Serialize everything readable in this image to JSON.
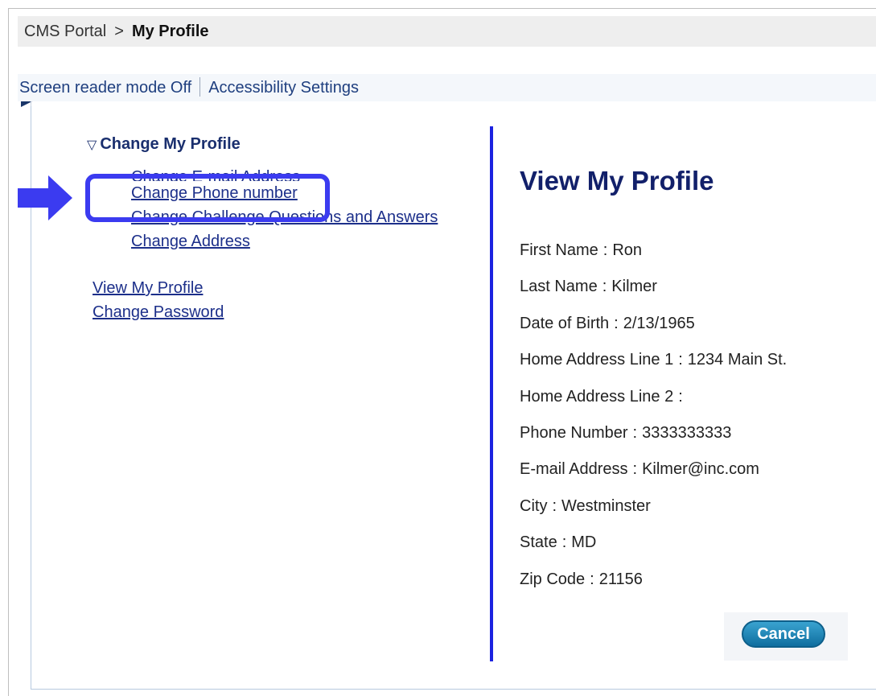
{
  "breadcrumb": {
    "root": "CMS Portal",
    "separator": ">",
    "current": "My Profile"
  },
  "accessibility": {
    "screen_reader": "Screen reader mode Off",
    "settings": "Accessibility Settings"
  },
  "menu": {
    "heading_icon": "▽",
    "heading": "Change My Profile",
    "items": [
      {
        "label": "Change E-mail Address"
      },
      {
        "label": "Change Phone number"
      },
      {
        "label": "Change Challenge Questions and Answers"
      },
      {
        "label": "Change Address"
      }
    ],
    "links": [
      {
        "label": "View My Profile"
      },
      {
        "label": "Change Password"
      }
    ]
  },
  "profile": {
    "title": "View My Profile",
    "fields": [
      {
        "label": "First Name",
        "value": "Ron"
      },
      {
        "label": "Last Name",
        "value": "Kilmer"
      },
      {
        "label": "Date of Birth",
        "value": "2/13/1965"
      },
      {
        "label": "Home Address Line 1",
        "value": "1234 Main St."
      },
      {
        "label": "Home Address Line 2",
        "value": ""
      },
      {
        "label": "Phone Number",
        "value": "3333333333"
      },
      {
        "label": "E-mail Address",
        "value": "Kilmer@inc.com"
      },
      {
        "label": "City",
        "value": "Westminster"
      },
      {
        "label": "State",
        "value": "MD"
      },
      {
        "label": "Zip Code",
        "value": "21156"
      }
    ],
    "colon": ":",
    "cancel_label": "Cancel"
  },
  "colors": {
    "highlight": "#3b3bf0",
    "link": "#1c2f8a",
    "divider": "#1c22e0",
    "title": "#12206a"
  }
}
